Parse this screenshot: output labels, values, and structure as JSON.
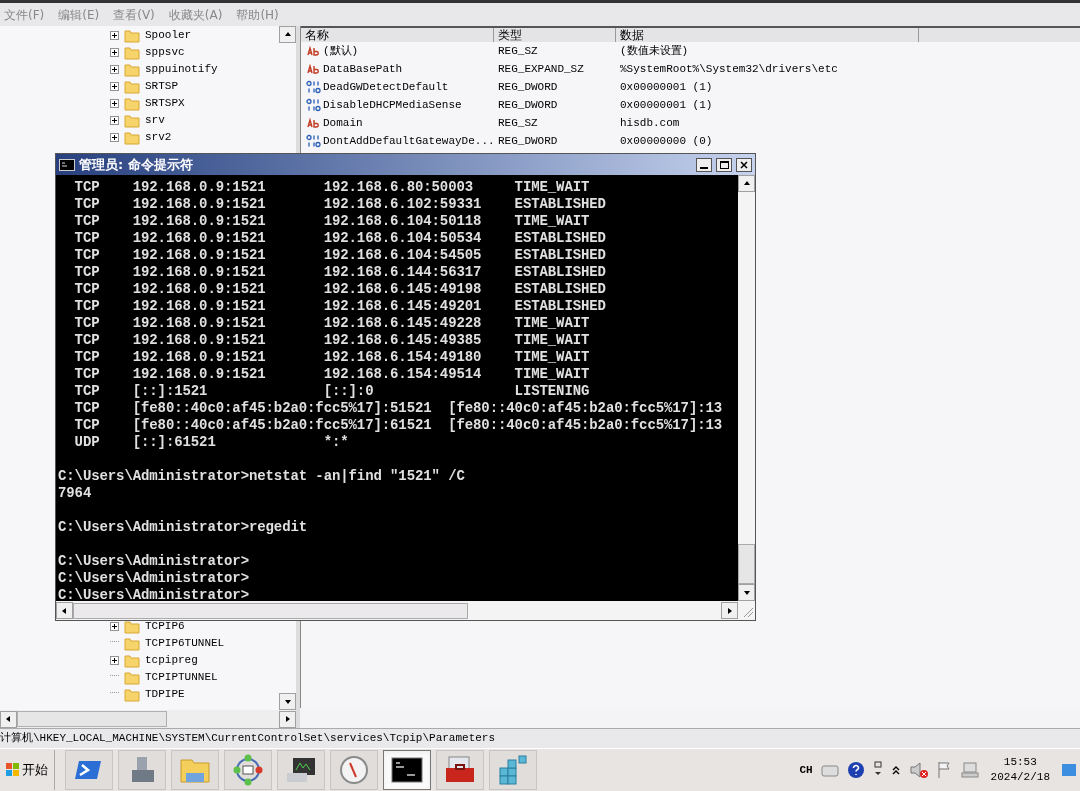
{
  "regedit": {
    "menu": [
      "文件(F)",
      "编辑(E)",
      "查看(V)",
      "收藏夹(A)",
      "帮助(H)"
    ],
    "tree_top": [
      {
        "label": "Spooler",
        "expandable": true
      },
      {
        "label": "sppsvc",
        "expandable": true
      },
      {
        "label": "sppuinotify",
        "expandable": true
      },
      {
        "label": "SRTSP",
        "expandable": true
      },
      {
        "label": "SRTSPX",
        "expandable": true
      },
      {
        "label": "srv",
        "expandable": true
      },
      {
        "label": "srv2",
        "expandable": true
      }
    ],
    "tree_bottom": [
      {
        "label": "TCPIP6",
        "expandable": true
      },
      {
        "label": "TCPIP6TUNNEL",
        "expandable": false
      },
      {
        "label": "tcpipreg",
        "expandable": true
      },
      {
        "label": "TCPIPTUNNEL",
        "expandable": false
      },
      {
        "label": "TDPIPE",
        "expandable": false
      }
    ],
    "columns": [
      "名称",
      "类型",
      "数据"
    ],
    "rows": [
      {
        "kind": "string",
        "name": "(默认)",
        "type": "REG_SZ",
        "data": "(数值未设置)"
      },
      {
        "kind": "string",
        "name": "DataBasePath",
        "type": "REG_EXPAND_SZ",
        "data": "%SystemRoot%\\System32\\drivers\\etc"
      },
      {
        "kind": "dword",
        "name": "DeadGWDetectDefault",
        "type": "REG_DWORD",
        "data": "0x00000001 (1)"
      },
      {
        "kind": "dword",
        "name": "DisableDHCPMediaSense",
        "type": "REG_DWORD",
        "data": "0x00000001 (1)"
      },
      {
        "kind": "string",
        "name": "Domain",
        "type": "REG_SZ",
        "data": "hisdb.com"
      },
      {
        "kind": "dword",
        "name": "DontAddDefaultGatewayDe...",
        "type": "REG_DWORD",
        "data": "0x00000000 (0)"
      }
    ],
    "status_path": "计算机\\HKEY_LOCAL_MACHINE\\SYSTEM\\CurrentControlSet\\services\\Tcpip\\Parameters"
  },
  "console": {
    "title": "管理员: 命令提示符",
    "blocks": [
      [
        "  TCP    192.168.0.9:1521       192.168.6.80:50003     TIME_WAIT",
        "  TCP    192.168.0.9:1521       192.168.6.102:59331    ESTABLISHED",
        "  TCP    192.168.0.9:1521       192.168.6.104:50118    TIME_WAIT",
        "  TCP    192.168.0.9:1521       192.168.6.104:50534    ESTABLISHED",
        "  TCP    192.168.0.9:1521       192.168.6.104:54505    ESTABLISHED",
        "  TCP    192.168.0.9:1521       192.168.6.144:56317    ESTABLISHED",
        "  TCP    192.168.0.9:1521       192.168.6.145:49198    ESTABLISHED",
        "  TCP    192.168.0.9:1521       192.168.6.145:49201    ESTABLISHED",
        "  TCP    192.168.0.9:1521       192.168.6.145:49228    TIME_WAIT",
        "  TCP    192.168.0.9:1521       192.168.6.145:49385    TIME_WAIT",
        "  TCP    192.168.0.9:1521       192.168.6.154:49180    TIME_WAIT",
        "  TCP    192.168.0.9:1521       192.168.6.154:49514    TIME_WAIT",
        "  TCP    [::]:1521              [::]:0                 LISTENING",
        "  TCP    [fe80::40c0:af45:b2a0:fcc5%17]:51521  [fe80::40c0:af45:b2a0:fcc5%17]:13",
        "  TCP    [fe80::40c0:af45:b2a0:fcc5%17]:61521  [fe80::40c0:af45:b2a0:fcc5%17]:13",
        "  UDP    [::]:61521             *:*"
      ],
      [
        "C:\\Users\\Administrator>netstat -an|find \"1521\" /C",
        "7964"
      ],
      [
        "C:\\Users\\Administrator>regedit"
      ],
      [
        "C:\\Users\\Administrator>",
        "C:\\Users\\Administrator>",
        "C:\\Users\\Administrator>"
      ]
    ]
  },
  "taskbar": {
    "start_label": "开始",
    "apps": [
      {
        "kind": "powershell",
        "selected": false
      },
      {
        "kind": "server",
        "selected": false
      },
      {
        "kind": "folder",
        "selected": false
      },
      {
        "kind": "network",
        "selected": false
      },
      {
        "kind": "monitor",
        "selected": false
      },
      {
        "kind": "gauge",
        "selected": false
      },
      {
        "kind": "console",
        "selected": true
      },
      {
        "kind": "toolbox",
        "selected": false
      },
      {
        "kind": "cubes",
        "selected": false
      }
    ],
    "language": "CH",
    "time": "15:53",
    "date": "2024/2/18"
  }
}
